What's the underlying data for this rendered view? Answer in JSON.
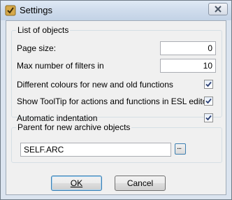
{
  "window": {
    "title": "Settings"
  },
  "list_group": {
    "legend": "List of objects",
    "page_size": {
      "label": "Page size:",
      "value": "0"
    },
    "max_filters": {
      "label": "Max number of filters in",
      "value": "10"
    },
    "options": [
      {
        "label": "Different colours for new and old functions",
        "checked": true
      },
      {
        "label": "Show ToolTip for actions and functions in ESL editor",
        "checked": true
      },
      {
        "label": "Automatic indentation",
        "checked": true
      }
    ]
  },
  "archive_group": {
    "legend": "Parent for new archive objects",
    "value": "SELF.ARC",
    "browse_label": "..."
  },
  "buttons": {
    "ok": "OK",
    "cancel": "Cancel"
  }
}
